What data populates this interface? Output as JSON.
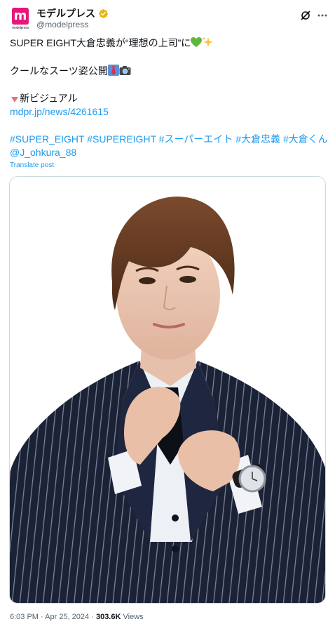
{
  "author": {
    "display_name": "モデルプレス",
    "handle": "@modelpress",
    "avatar_text": "m",
    "avatar_subtext": "modelpress",
    "verified_color": "#e2b719"
  },
  "tweet": {
    "line1": "SUPER EIGHT大倉忠義が“理想の上司”に",
    "line2": "クールなスーツ姿公開",
    "line3": "新ビジュアル",
    "link": "mdpr.jp/news/4261615",
    "hashtags": "#SUPER_EIGHT #SUPEREIGHT #スーパーエイト #大倉忠義 #大倉くん",
    "mention": "@J_ohkura_88",
    "translate_label": "Translate post"
  },
  "icons": {
    "verified": "verified-badge-icon",
    "grok": "grok-icon",
    "more": "more-options-icon",
    "green_heart": "green-heart-icon",
    "sparkles": "sparkles-icon",
    "necktie": "necktie-icon",
    "camera": "camera-icon",
    "triangle": "down-triangle-icon"
  },
  "meta": {
    "time": "6:03 PM",
    "separator": "·",
    "date": "Apr 25, 2024",
    "views_count": "303.6K",
    "views_label": "Views"
  },
  "colors": {
    "link": "#1d9bf0",
    "brand": "#e4177a",
    "text": "#0f1419",
    "muted": "#536471"
  }
}
